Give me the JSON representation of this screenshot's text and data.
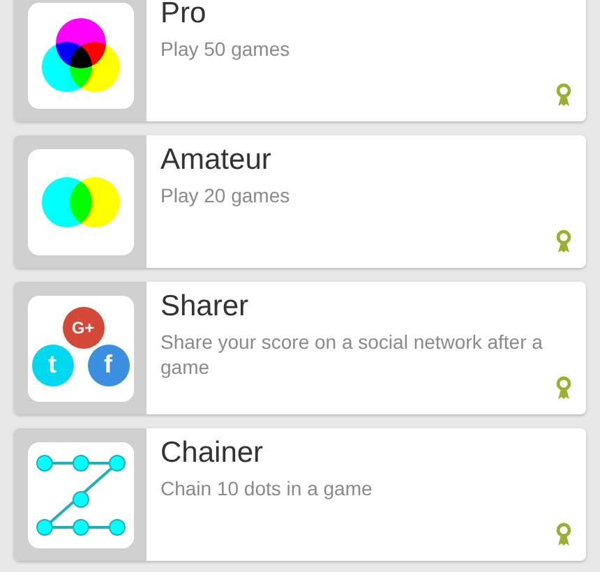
{
  "achievements": [
    {
      "kind": "cmy",
      "title": "Pro",
      "description": "Play 50 games"
    },
    {
      "kind": "cmy-pair",
      "title": "Amateur",
      "description": "Play 20 games"
    },
    {
      "kind": "social",
      "title": "Sharer",
      "description": "Share your score on a social network after a game",
      "icon_labels": [
        "G+",
        "t",
        "f"
      ]
    },
    {
      "kind": "chain",
      "title": "Chainer",
      "description": "Chain 10 dots in a game"
    }
  ]
}
